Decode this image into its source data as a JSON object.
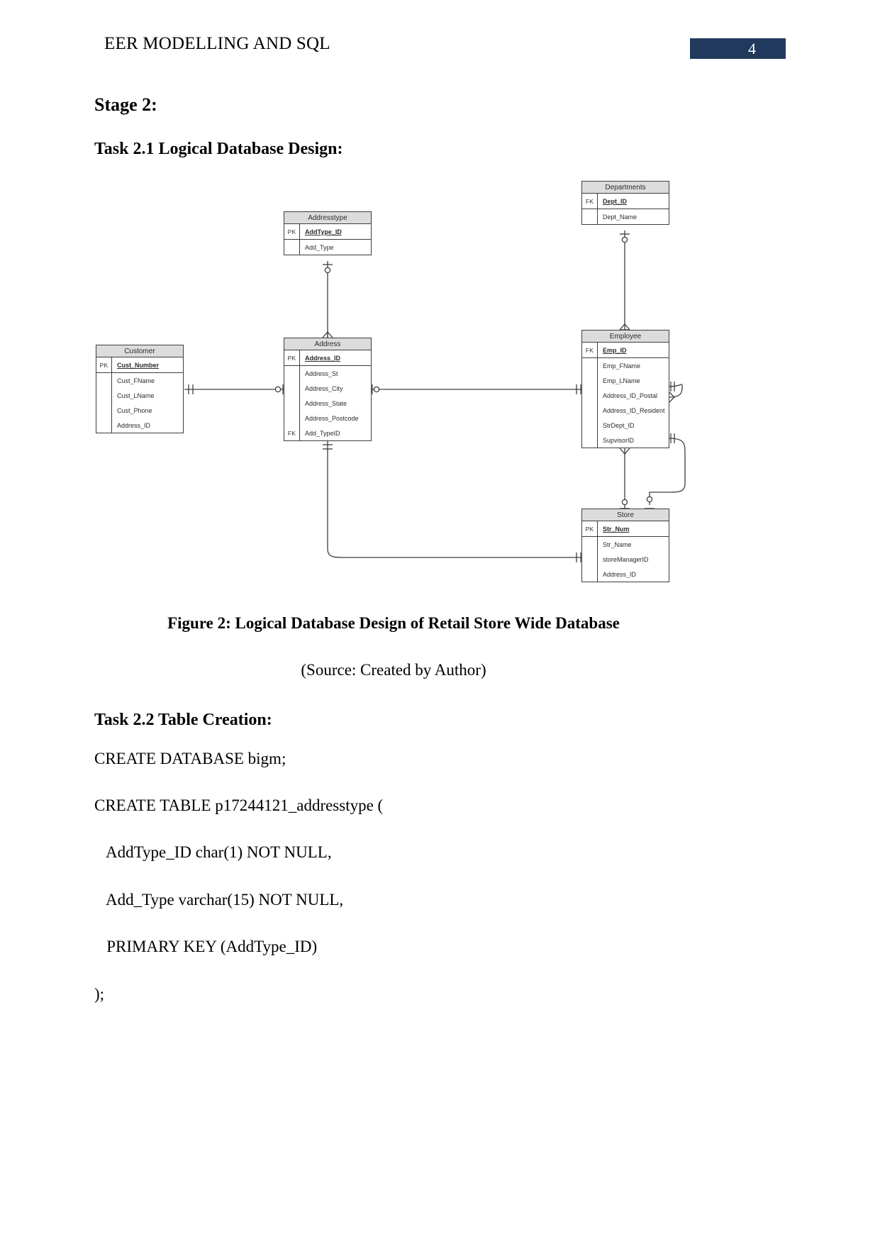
{
  "document": {
    "running_header": "EER MODELLING AND SQL",
    "page_number": "4"
  },
  "headings": {
    "stage": "Stage 2:",
    "task_2_1": "Task 2.1 Logical Database Design:",
    "task_2_2": "Task 2.2 Table Creation:"
  },
  "figure": {
    "caption": "Figure 2: Logical Database Design of Retail Store Wide Database",
    "source": "(Source: Created by Author)"
  },
  "sql": {
    "lines": [
      "CREATE DATABASE bigm;",
      "CREATE TABLE p17244121_addresstype (",
      "   AddType_ID char(1) NOT NULL,",
      "   Add_Type varchar(15) NOT NULL,",
      "   PRIMARY KEY (AddType_ID)",
      ");"
    ]
  },
  "chart_data": {
    "type": "diagram",
    "subtype": "entity-relationship-logical-model",
    "title": "Logical Database Design of Retail Store Wide Database",
    "notation": "crow's foot",
    "entities": [
      {
        "id": "addresstype",
        "name": "Addresstype",
        "key_attributes": [
          {
            "key": "PK",
            "name": "AddType_ID"
          }
        ],
        "attributes": [
          {
            "key": "",
            "name": "Add_Type"
          }
        ]
      },
      {
        "id": "departments",
        "name": "Departments",
        "key_attributes": [
          {
            "key": "FK",
            "name": "Dept_ID"
          }
        ],
        "attributes": [
          {
            "key": "",
            "name": "Dept_Name"
          }
        ]
      },
      {
        "id": "customer",
        "name": "Customer",
        "key_attributes": [
          {
            "key": "PK",
            "name": "Cust_Number"
          }
        ],
        "attributes": [
          {
            "key": "",
            "name": "Cust_FName"
          },
          {
            "key": "",
            "name": "Cust_LName"
          },
          {
            "key": "",
            "name": "Cust_Phone"
          },
          {
            "key": "",
            "name": "Address_ID"
          }
        ]
      },
      {
        "id": "address",
        "name": "Address",
        "key_attributes": [
          {
            "key": "PK",
            "name": "Address_ID"
          }
        ],
        "attributes": [
          {
            "key": "",
            "name": "Address_St"
          },
          {
            "key": "",
            "name": "Address_City"
          },
          {
            "key": "",
            "name": "Address_State"
          },
          {
            "key": "",
            "name": "Address_Postcode"
          },
          {
            "key": "FK",
            "name": "Add_TypeID"
          }
        ]
      },
      {
        "id": "employee",
        "name": "Employee",
        "key_attributes": [
          {
            "key": "FK",
            "name": "Emp_ID"
          }
        ],
        "attributes": [
          {
            "key": "",
            "name": "Emp_FName"
          },
          {
            "key": "",
            "name": "Emp_LName"
          },
          {
            "key": "",
            "name": "Address_ID_Postal"
          },
          {
            "key": "",
            "name": "Address_ID_Resident"
          },
          {
            "key": "",
            "name": "StrDept_ID"
          },
          {
            "key": "",
            "name": "SupvisorID"
          }
        ]
      },
      {
        "id": "store",
        "name": "Store",
        "key_attributes": [
          {
            "key": "PK",
            "name": "Str_Num"
          }
        ],
        "attributes": [
          {
            "key": "",
            "name": "Str_Name"
          },
          {
            "key": "",
            "name": "storeManagerID"
          },
          {
            "key": "",
            "name": "Address_ID"
          }
        ]
      }
    ],
    "relationships": [
      {
        "from": "address",
        "to": "addresstype",
        "from_cardinality": "many",
        "to_cardinality": "zero-or-one"
      },
      {
        "from": "customer",
        "to": "address",
        "from_cardinality": "one",
        "to_cardinality": "zero-or-one"
      },
      {
        "from": "address",
        "to": "employee",
        "from_cardinality": "zero-or-one",
        "to_cardinality": "one"
      },
      {
        "from": "departments",
        "to": "employee",
        "from_cardinality": "zero-or-one",
        "to_cardinality": "many"
      },
      {
        "from": "employee",
        "to": "store",
        "from_cardinality": "many",
        "to_cardinality": "zero-or-one"
      },
      {
        "from": "employee",
        "to": "store",
        "from_cardinality": "one",
        "to_cardinality": "zero-or-one"
      },
      {
        "from": "employee",
        "to": "employee",
        "from_cardinality": "one",
        "to_cardinality": "many"
      },
      {
        "from": "address",
        "to": "store",
        "from_cardinality": "many",
        "to_cardinality": "one"
      }
    ],
    "colors": {
      "entity_header_fill": "#dcdcdc",
      "entity_body_fill": "#ffffff",
      "stroke": "#3d3d3d",
      "page_badge": "#21395c"
    }
  }
}
